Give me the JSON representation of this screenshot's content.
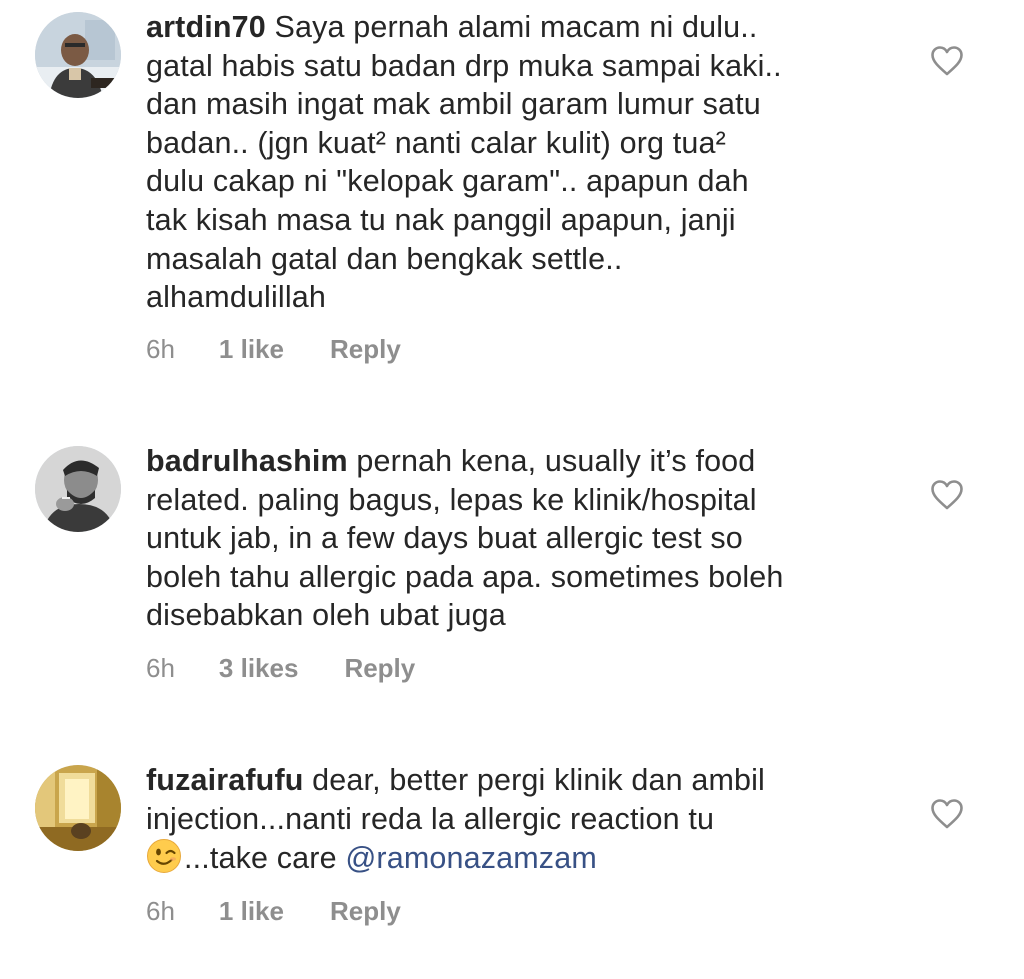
{
  "comments": [
    {
      "username": "artdin70",
      "text_lines": [
        "Saya pernah alami macam ni dulu..",
        "gatal habis satu badan drp muka sampai kaki..",
        "dan masih ingat mak ambil garam lumur satu",
        "badan.. (jgn kuat² nanti calar kulit) org tua²",
        "dulu cakap ni \"kelopak garam\".. apapun dah",
        "tak kisah masa tu nak panggil apapun, janji",
        "masalah gatal dan bengkak settle..",
        "alhamdulillah"
      ],
      "time": "6h",
      "likes": "1 like",
      "reply": "Reply",
      "avatar_icon": "man-portrait-avatar",
      "like_icon": "heart-outline-icon"
    },
    {
      "username": "badrulhashim",
      "text_lines": [
        "pernah kena, usually it’s food",
        "related. paling bagus, lepas ke klinik/hospital",
        "untuk jab, in a few days buat allergic test so",
        "boleh tahu allergic pada apa. sometimes boleh",
        "disebabkan oleh ubat juga"
      ],
      "time": "6h",
      "likes": "3 likes",
      "reply": "Reply",
      "avatar_icon": "grayscale-man-portrait-avatar",
      "like_icon": "heart-outline-icon"
    },
    {
      "username": "fuzairafufu",
      "text_lines": [
        "dear, better pergi klinik dan ambil",
        "injection...nanti reda la allergic reaction tu",
        "...take care"
      ],
      "emoji": "winking-face-emoji",
      "mention": "@ramonazamzam",
      "time": "6h",
      "likes": "1 like",
      "reply": "Reply",
      "avatar_icon": "golden-room-avatar",
      "like_icon": "heart-outline-icon"
    }
  ],
  "colors": {
    "text": "#262626",
    "meta": "#8e8e8e",
    "mention": "#385185",
    "heart_stroke": "#8e8e8e",
    "background": "#ffffff"
  }
}
